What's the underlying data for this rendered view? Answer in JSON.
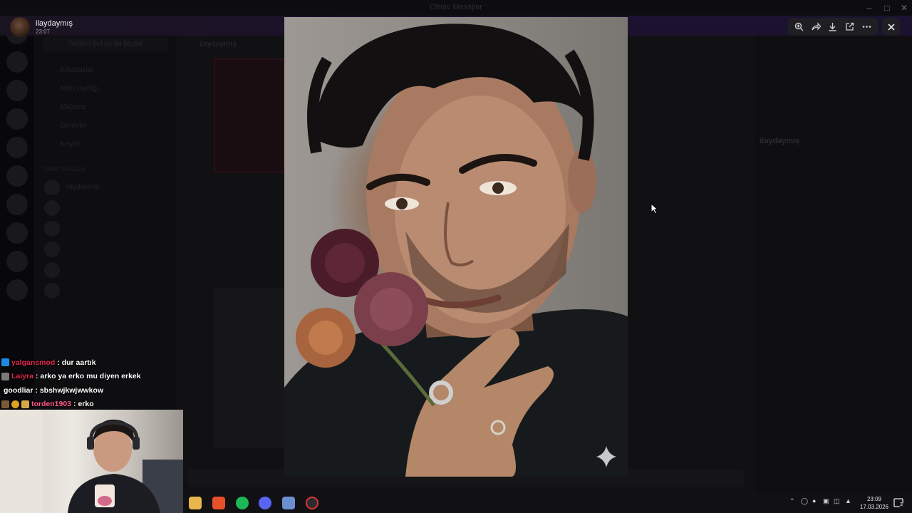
{
  "window": {
    "title": "Ofnav Mesajlar"
  },
  "viewer": {
    "user_name": "ilaydaymış",
    "timestamp": "23:07",
    "toolbar": {
      "zoom_icon": "zoom-in-icon",
      "forward_icon": "forward-icon",
      "download_icon": "download-icon",
      "open_external_icon": "open-external-icon",
      "more_icon": "more-options-icon",
      "close_icon": "close-icon"
    }
  },
  "background": {
    "channel_search": "Sohbet bul ya da başlat",
    "channel_items": [
      "Arkadaşlar",
      "Nitro Üyeliği",
      "Mağaza",
      "Görevler",
      "Keşfet"
    ],
    "dm_header": "Direkt Mesajlar",
    "dm_list": [
      "ilaydaymış",
      "",
      "",
      "",
      "",
      "",
      "",
      ""
    ],
    "chat_header": "ilaydaymış",
    "profile_name": "ilaydaymış"
  },
  "twitch_chat": [
    {
      "user": "yalgansmod",
      "user_color": "#e0284e",
      "message": ": dur aartık",
      "badge_color": "#1e88e5"
    },
    {
      "user": "Laiyra",
      "user_color": "#e0284e",
      "message": ": arko ya erko mu diyen erkek",
      "badge_color": "#7a7a7a"
    },
    {
      "user": "goodliar",
      "user_color": "#ffffff",
      "message": ": sbshwjkwjwwkow",
      "badge_color": ""
    },
    {
      "user": "torden1903",
      "user_color": "#ff5c8a",
      "message": ": erko",
      "badge_color": "#e0a020"
    }
  ],
  "taskbar": {
    "apps": [
      "file-explorer-icon",
      "brave-browser-icon",
      "spotify-icon",
      "discord-icon",
      "settings-app-icon",
      "obs-icon"
    ],
    "clock_time": "23:09",
    "clock_date": "17.03.2026",
    "notification_count": "3"
  },
  "colors": {
    "topbar_purple": "#1c1230",
    "toolbar_bg": "#1f1f23",
    "taskbar_bg": "#111114"
  }
}
